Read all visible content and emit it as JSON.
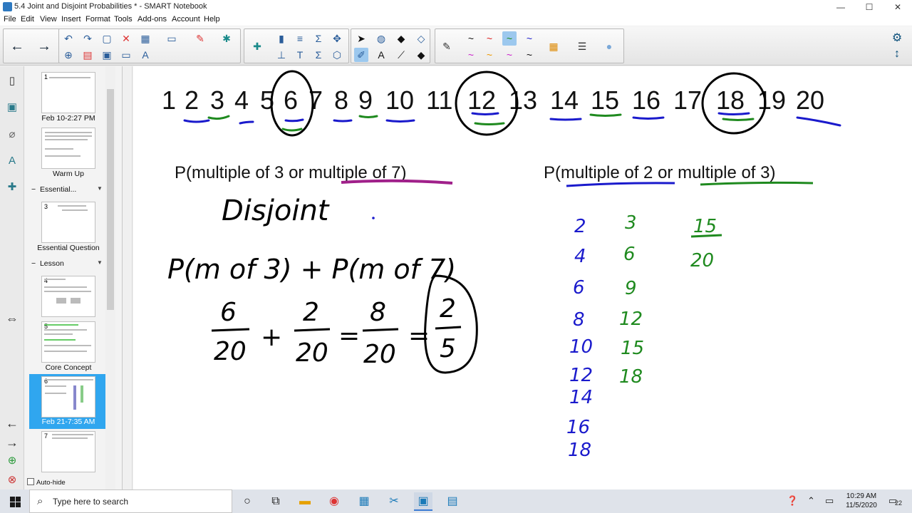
{
  "window": {
    "title": "5.4 Joint and Disjoint Probabilities * - SMART Notebook",
    "minimize": "—",
    "maximize": "☐",
    "close": "✕"
  },
  "menu": [
    "File",
    "Edit",
    "View",
    "Insert",
    "Format",
    "Tools",
    "Add-ons",
    "Account",
    "Help"
  ],
  "sidebar": {
    "thumbnails": [
      {
        "num": "1",
        "text": "Probability of Disjoint & Overlapping Events",
        "label": "Feb 10-2:27 PM"
      },
      {
        "num": "",
        "text": "Determine whether events are disjoint",
        "label": "Warm Up"
      },
      {
        "num": "3",
        "text": "Essential Question",
        "label": "Essential Question"
      },
      {
        "num": "4",
        "text": "Probability Notation",
        "label": ""
      },
      {
        "num": "5",
        "text": "Disjoint (Mutually Exclusive)",
        "label": "Core Concept"
      },
      {
        "num": "6",
        "text": "",
        "label": "Feb 21-7:35 AM"
      },
      {
        "num": "7",
        "text": "",
        "label": ""
      }
    ],
    "sections": [
      "Essential...",
      "Lesson"
    ],
    "autohide": "Auto-hide"
  },
  "canvas": {
    "number_line": [
      "1",
      "2",
      "3",
      "4",
      "5",
      "6",
      "7",
      "8",
      "9",
      "10",
      "11",
      "12",
      "13",
      "14",
      "15",
      "16",
      "17",
      "18",
      "19",
      "20"
    ],
    "left_heading_prefix": "P(multiple of 3 or ",
    "left_heading_under": "multiple of 7",
    "left_heading_suffix": ")",
    "right_heading_prefix": "P(",
    "right_heading_under1": "multiple of 2",
    "right_heading_mid": " or ",
    "right_heading_under2": "multiple of 3",
    "right_heading_suffix": ")",
    "handwriting": {
      "disjoint": "Disjoint",
      "formula": "P(m of 3) + P(m of 7)",
      "frac1_num": "6",
      "frac1_den": "20",
      "plus": "+",
      "frac2_num": "2",
      "frac2_den": "20",
      "eq1": "=",
      "frac3_num": "8",
      "frac3_den": "20",
      "eq2": "=",
      "frac4_num": "2",
      "frac4_den": "5",
      "multiples_of_2": [
        "2",
        "4",
        "6",
        "8",
        "10",
        "12",
        "14",
        "16",
        "18"
      ],
      "multiples_of_3": [
        "3",
        "6",
        "9",
        "12",
        "15",
        "18"
      ],
      "result_num": "15",
      "result_den": "20"
    },
    "colors": {
      "blue": "#1a1acc",
      "green": "#1f8a1f",
      "purple": "#a0208a",
      "ink": "#000000"
    }
  },
  "taskbar": {
    "search_placeholder": "Type here to search",
    "time": "10:29 AM",
    "date": "11/5/2020",
    "notifications": "22"
  }
}
